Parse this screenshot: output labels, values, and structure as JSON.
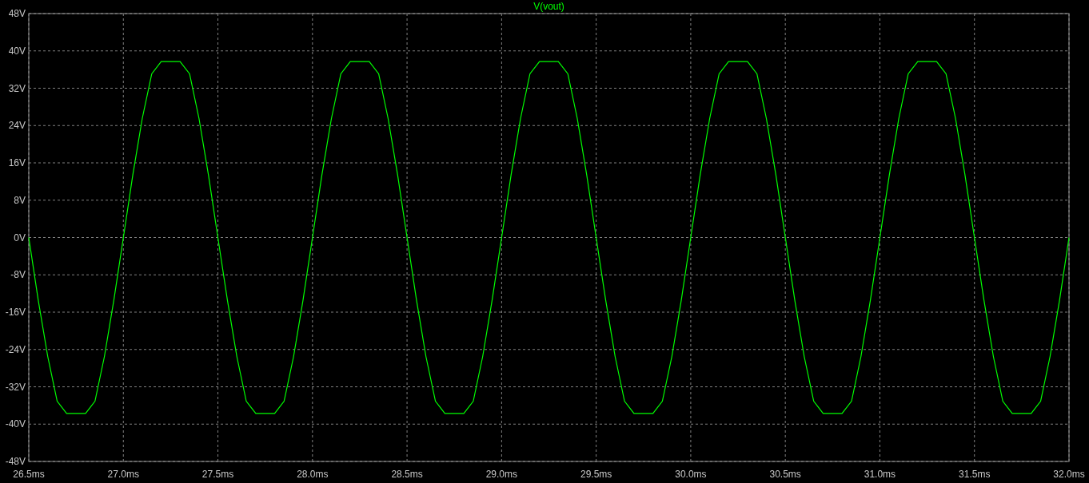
{
  "plot": {
    "chart_data": {
      "type": "line",
      "grid": true,
      "xlim": [
        26.5,
        32.0
      ],
      "ylim": [
        -48,
        48
      ],
      "xticks": [
        {
          "value": 26.5,
          "label": "26.5ms"
        },
        {
          "value": 27.0,
          "label": "27.0ms"
        },
        {
          "value": 27.5,
          "label": "27.5ms"
        },
        {
          "value": 28.0,
          "label": "28.0ms"
        },
        {
          "value": 28.5,
          "label": "28.5ms"
        },
        {
          "value": 29.0,
          "label": "29.0ms"
        },
        {
          "value": 29.5,
          "label": "29.5ms"
        },
        {
          "value": 30.0,
          "label": "30.0ms"
        },
        {
          "value": 30.5,
          "label": "30.5ms"
        },
        {
          "value": 31.0,
          "label": "31.0ms"
        },
        {
          "value": 31.5,
          "label": "31.5ms"
        },
        {
          "value": 32.0,
          "label": "32.0ms"
        }
      ],
      "yticks": [
        {
          "value": 48,
          "label": "48V"
        },
        {
          "value": 40,
          "label": "40V"
        },
        {
          "value": 32,
          "label": "32V"
        },
        {
          "value": 24,
          "label": "24V"
        },
        {
          "value": 16,
          "label": "16V"
        },
        {
          "value": 8,
          "label": "8V"
        },
        {
          "value": 0,
          "label": "0V"
        },
        {
          "value": -8,
          "label": "-8V"
        },
        {
          "value": -16,
          "label": "-16V"
        },
        {
          "value": -24,
          "label": "-24V"
        },
        {
          "value": -32,
          "label": "-32V"
        },
        {
          "value": -40,
          "label": "-40V"
        },
        {
          "value": -48,
          "label": "-48V"
        }
      ],
      "x": [
        26.5,
        26.55,
        26.6,
        26.65,
        26.7,
        26.75,
        26.8,
        26.85,
        26.9,
        26.95,
        27.0,
        27.05,
        27.1,
        27.15,
        27.2,
        27.25,
        27.3,
        27.35,
        27.4,
        27.45,
        27.5,
        27.55,
        27.6,
        27.65,
        27.7,
        27.75,
        27.8,
        27.85,
        27.9,
        27.95,
        28.0,
        28.05,
        28.1,
        28.15,
        28.2,
        28.25,
        28.3,
        28.35,
        28.4,
        28.45,
        28.5,
        28.55,
        28.6,
        28.65,
        28.7,
        28.75,
        28.8,
        28.85,
        28.9,
        28.95,
        29.0,
        29.05,
        29.1,
        29.15,
        29.2,
        29.25,
        29.3,
        29.35,
        29.4,
        29.45,
        29.5,
        29.55,
        29.6,
        29.65,
        29.7,
        29.75,
        29.8,
        29.85,
        29.9,
        29.95,
        30.0,
        30.05,
        30.1,
        30.15,
        30.2,
        30.25,
        30.3,
        30.35,
        30.4,
        30.45,
        30.5,
        30.55,
        30.6,
        30.65,
        30.7,
        30.75,
        30.8,
        30.85,
        30.9,
        30.95,
        31.0,
        31.05,
        31.1,
        31.15,
        31.2,
        31.25,
        31.3,
        31.35,
        31.4,
        31.45,
        31.5,
        31.55,
        31.6,
        31.65,
        31.7,
        31.75,
        31.8,
        31.85,
        31.9,
        31.95,
        32.0
      ],
      "series": [
        {
          "name": "V(vout)",
          "color": "#00ff00",
          "values": [
            0,
            -13.4,
            -25.5,
            -35.1,
            -37.7,
            -37.7,
            -37.7,
            -35.1,
            -25.5,
            -13.4,
            0,
            13.4,
            25.5,
            35.1,
            37.7,
            37.7,
            37.7,
            35.1,
            25.5,
            13.4,
            0,
            -13.4,
            -25.5,
            -35.1,
            -37.7,
            -37.7,
            -37.7,
            -35.1,
            -25.5,
            -13.4,
            0,
            13.4,
            25.5,
            35.1,
            37.7,
            37.7,
            37.7,
            35.1,
            25.5,
            13.4,
            0,
            -13.4,
            -25.5,
            -35.1,
            -37.7,
            -37.7,
            -37.7,
            -35.1,
            -25.5,
            -13.4,
            0,
            13.4,
            25.5,
            35.1,
            37.7,
            37.7,
            37.7,
            35.1,
            25.5,
            13.4,
            0,
            -13.4,
            -25.5,
            -35.1,
            -37.7,
            -37.7,
            -37.7,
            -35.1,
            -25.5,
            -13.4,
            0,
            13.4,
            25.5,
            35.1,
            37.7,
            37.7,
            37.7,
            35.1,
            25.5,
            13.4,
            0,
            -13.4,
            -25.5,
            -35.1,
            -37.7,
            -37.7,
            -37.7,
            -35.1,
            -25.5,
            -13.4,
            0,
            13.4,
            25.5,
            35.1,
            37.7,
            37.7,
            37.7,
            35.1,
            25.5,
            13.4,
            0,
            -13.4,
            -25.5,
            -35.1,
            -37.7,
            -37.7,
            -37.7,
            -35.1,
            -25.5,
            -13.4,
            0
          ]
        }
      ]
    }
  }
}
